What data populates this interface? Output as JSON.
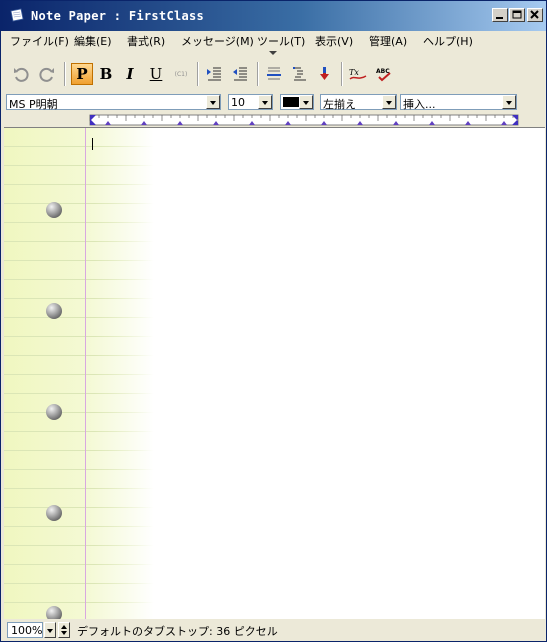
{
  "window": {
    "title": "Note Paper : FirstClass",
    "accent": "#0a246a"
  },
  "menu": [
    "ファイル(F)",
    "編集(E)",
    "書式(R)",
    "メッセージ(M)",
    "ツール(T)",
    "表示(V)",
    "管理(A)",
    "ヘルプ(H)"
  ],
  "toolbar": {
    "plain_label": "P",
    "bold_label": "B",
    "italic_label": "I",
    "underline_label": "U",
    "superscript_label": "(C1)"
  },
  "format": {
    "font": "MS P明朝",
    "size": "10",
    "color": "#000000",
    "align": "左揃え",
    "insert": "挿入..."
  },
  "status": {
    "zoom": "100%",
    "message": "デフォルトのタブストップ: 36 ピクセル"
  }
}
